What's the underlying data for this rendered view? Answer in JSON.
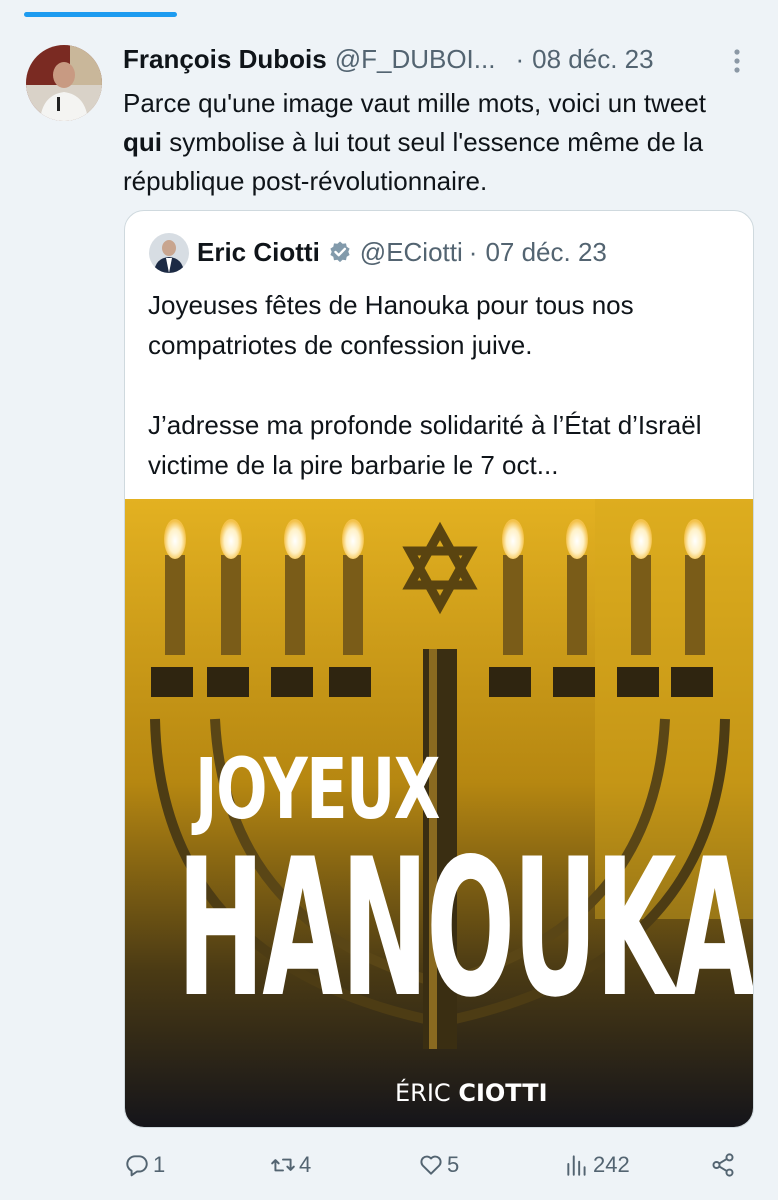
{
  "tweet": {
    "author_name": "François Dubois",
    "author_handle": "@F_DUBOI...",
    "separator": "·",
    "date": "08 déc. 23",
    "text_part1": "Parce qu'une image vaut mille mots, voici un tweet ",
    "text_bold": "qui",
    "text_part2": " symbolise à lui tout seul l'essence même de la république post-révolutionnaire."
  },
  "quoted": {
    "author_name": "Eric Ciotti",
    "author_handle": "@ECiotti",
    "separator": "·",
    "date": "07 déc. 23",
    "paragraph1": "Joyeuses fêtes de Hanouka pour tous nos compatriotes de confession juive.",
    "paragraph2": "J’adresse ma profonde solidarité à l’État d’Israël victime de la pire barbarie le 7 oct...",
    "media": {
      "title_line1": "JOYEUX",
      "title_line2": "HANOUKA",
      "signature_first": "ÉRIC",
      "signature_last": "CIOTTI"
    }
  },
  "actions": {
    "reply_count": "1",
    "retweet_count": "4",
    "like_count": "5",
    "view_count": "242"
  },
  "icons": [
    "more-icon",
    "verified-icon",
    "reply-icon",
    "retweet-icon",
    "like-icon",
    "views-icon",
    "share-icon"
  ],
  "colors": {
    "accent": "#1d9bf0",
    "background": "#eef3f7",
    "secondary_text": "#536471",
    "verified_badge": "#829aab"
  }
}
